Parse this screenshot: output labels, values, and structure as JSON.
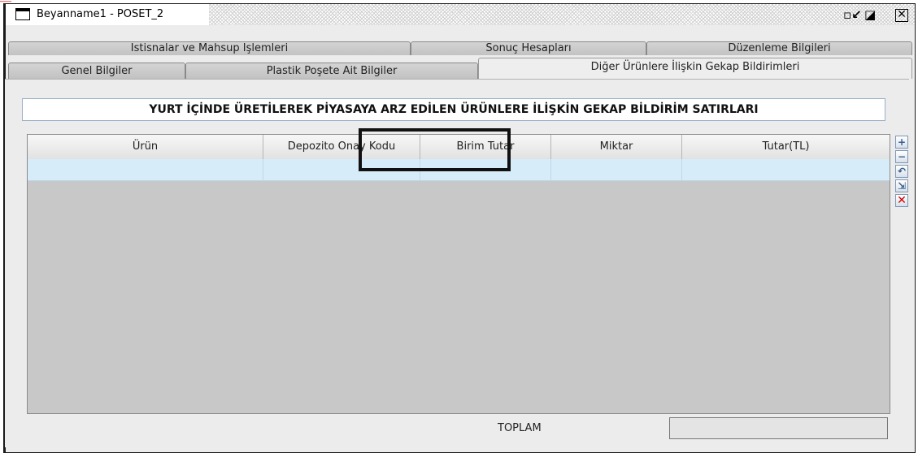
{
  "window": {
    "title": "Beyanname1 - POSET_2",
    "controls": [
      "restore",
      "maximize",
      "close"
    ]
  },
  "tabs": {
    "top_row": [
      "İstisnalar ve Mahsup İşlemleri",
      "Sonuç Hesapları",
      "Düzenleme Bilgileri"
    ],
    "bottom_row": [
      "Genel Bilgiler",
      "Plastik Poşete Ait Bilgiler",
      "Diğer Ürünlere İlişkin Gekap Bildirimleri"
    ],
    "active": "Diğer Ürünlere İlişkin Gekap Bildirimleri"
  },
  "section": {
    "title": "YURT İÇİNDE ÜRETİLEREK PİYASAYA ARZ EDİLEN ÜRÜNLERE İLİŞKİN GEKAP BİLDİRİM SATIRLARI"
  },
  "table": {
    "columns": [
      "Ürün",
      "Depozito Onay Kodu",
      "Birim Tutar",
      "Miktar",
      "Tutar(TL)"
    ],
    "rows": [
      [
        "",
        "",
        "",
        "",
        ""
      ]
    ]
  },
  "toolbar": {
    "icons": [
      "add-row-icon",
      "remove-row-icon",
      "undo-icon",
      "import-icon",
      "delete-icon"
    ]
  },
  "footer": {
    "total_label": "TOPLAM",
    "total_value": ""
  },
  "colors": {
    "selected_row": "#d6ecf8",
    "delete_icon": "#d10000",
    "highlight_box": "#111111"
  }
}
